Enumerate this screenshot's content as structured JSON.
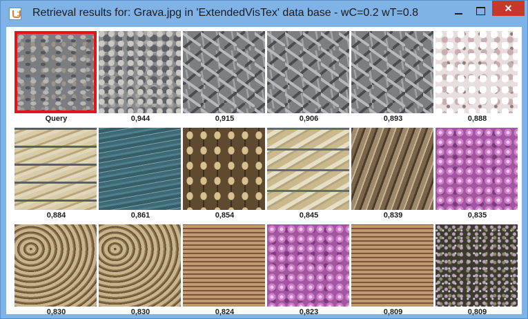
{
  "window": {
    "title": "Retrieval results for: Grava.jpg in 'ExtendedVisTex' data base - wC=0.2 wT=0.8",
    "icon": "java-cup-icon",
    "controls": {
      "minimize": "minimize-icon",
      "maximize": "maximize-icon",
      "close": "✕"
    }
  },
  "results": [
    {
      "label": "Query",
      "texture": "gravel",
      "is_query": true
    },
    {
      "label": "0,944",
      "texture": "stone"
    },
    {
      "label": "0,915",
      "texture": "granite"
    },
    {
      "label": "0,906",
      "texture": "granite"
    },
    {
      "label": "0,893",
      "texture": "granite"
    },
    {
      "label": "0,888",
      "texture": "blossom"
    },
    {
      "label": "0,884",
      "texture": "brick"
    },
    {
      "label": "0,861",
      "texture": "water"
    },
    {
      "label": "0,854",
      "texture": "rope"
    },
    {
      "label": "0,845",
      "texture": "brick2"
    },
    {
      "label": "0,839",
      "texture": "bark"
    },
    {
      "label": "0,835",
      "texture": "phlox"
    },
    {
      "label": "0,830",
      "texture": "wood"
    },
    {
      "label": "0,830",
      "texture": "wood"
    },
    {
      "label": "0,824",
      "texture": "wicker"
    },
    {
      "label": "0,823",
      "texture": "phlox"
    },
    {
      "label": "0,809",
      "texture": "wicker"
    },
    {
      "label": "0,809",
      "texture": "heather"
    }
  ],
  "colors": {
    "titlebar": "#7fb2e6",
    "close_button": "#c7372a",
    "query_border": "#e3141b"
  }
}
